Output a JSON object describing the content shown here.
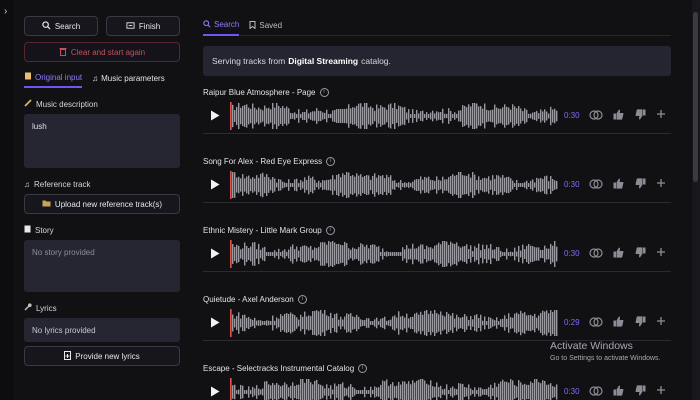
{
  "left_panel": {
    "search_button": "Search",
    "finish_button": "Finish",
    "clear_button": "Clear and start again",
    "tabs": [
      "Original input",
      "Music parameters"
    ],
    "music_description_label": "Music description",
    "music_description_value": "lush",
    "reference_track_label": "Reference track",
    "upload_button": "Upload new reference track(s)",
    "story_label": "Story",
    "story_placeholder": "No story provided",
    "lyrics_label": "Lyrics",
    "lyrics_value": "No lyrics provided",
    "provide_lyrics_button": "Provide new lyrics"
  },
  "results": {
    "tabs": [
      "Search",
      "Saved"
    ],
    "banner_prefix": "Serving tracks from",
    "banner_catalog": "Digital Streaming",
    "banner_suffix": "catalog.",
    "tracks": [
      {
        "title": "Raipur Blue Atmosphere - Page",
        "duration": "0:30"
      },
      {
        "title": "Song For Alex - Red Eye Express",
        "duration": "0:30"
      },
      {
        "title": "Ethnic Mistery - Little Mark Group",
        "duration": "0:30"
      },
      {
        "title": "Quietude - Axel Anderson",
        "duration": "0:29"
      },
      {
        "title": "Escape - Selectracks Instrumental Catalog",
        "duration": "0:30"
      }
    ]
  },
  "watermark": {
    "title": "Activate Windows",
    "subtitle": "Go to Settings to activate Windows."
  },
  "colors": {
    "accent": "#6c57f5",
    "danger": "#c2525f",
    "waveform": "#9a9aa0",
    "playhead": "#e0544e"
  }
}
